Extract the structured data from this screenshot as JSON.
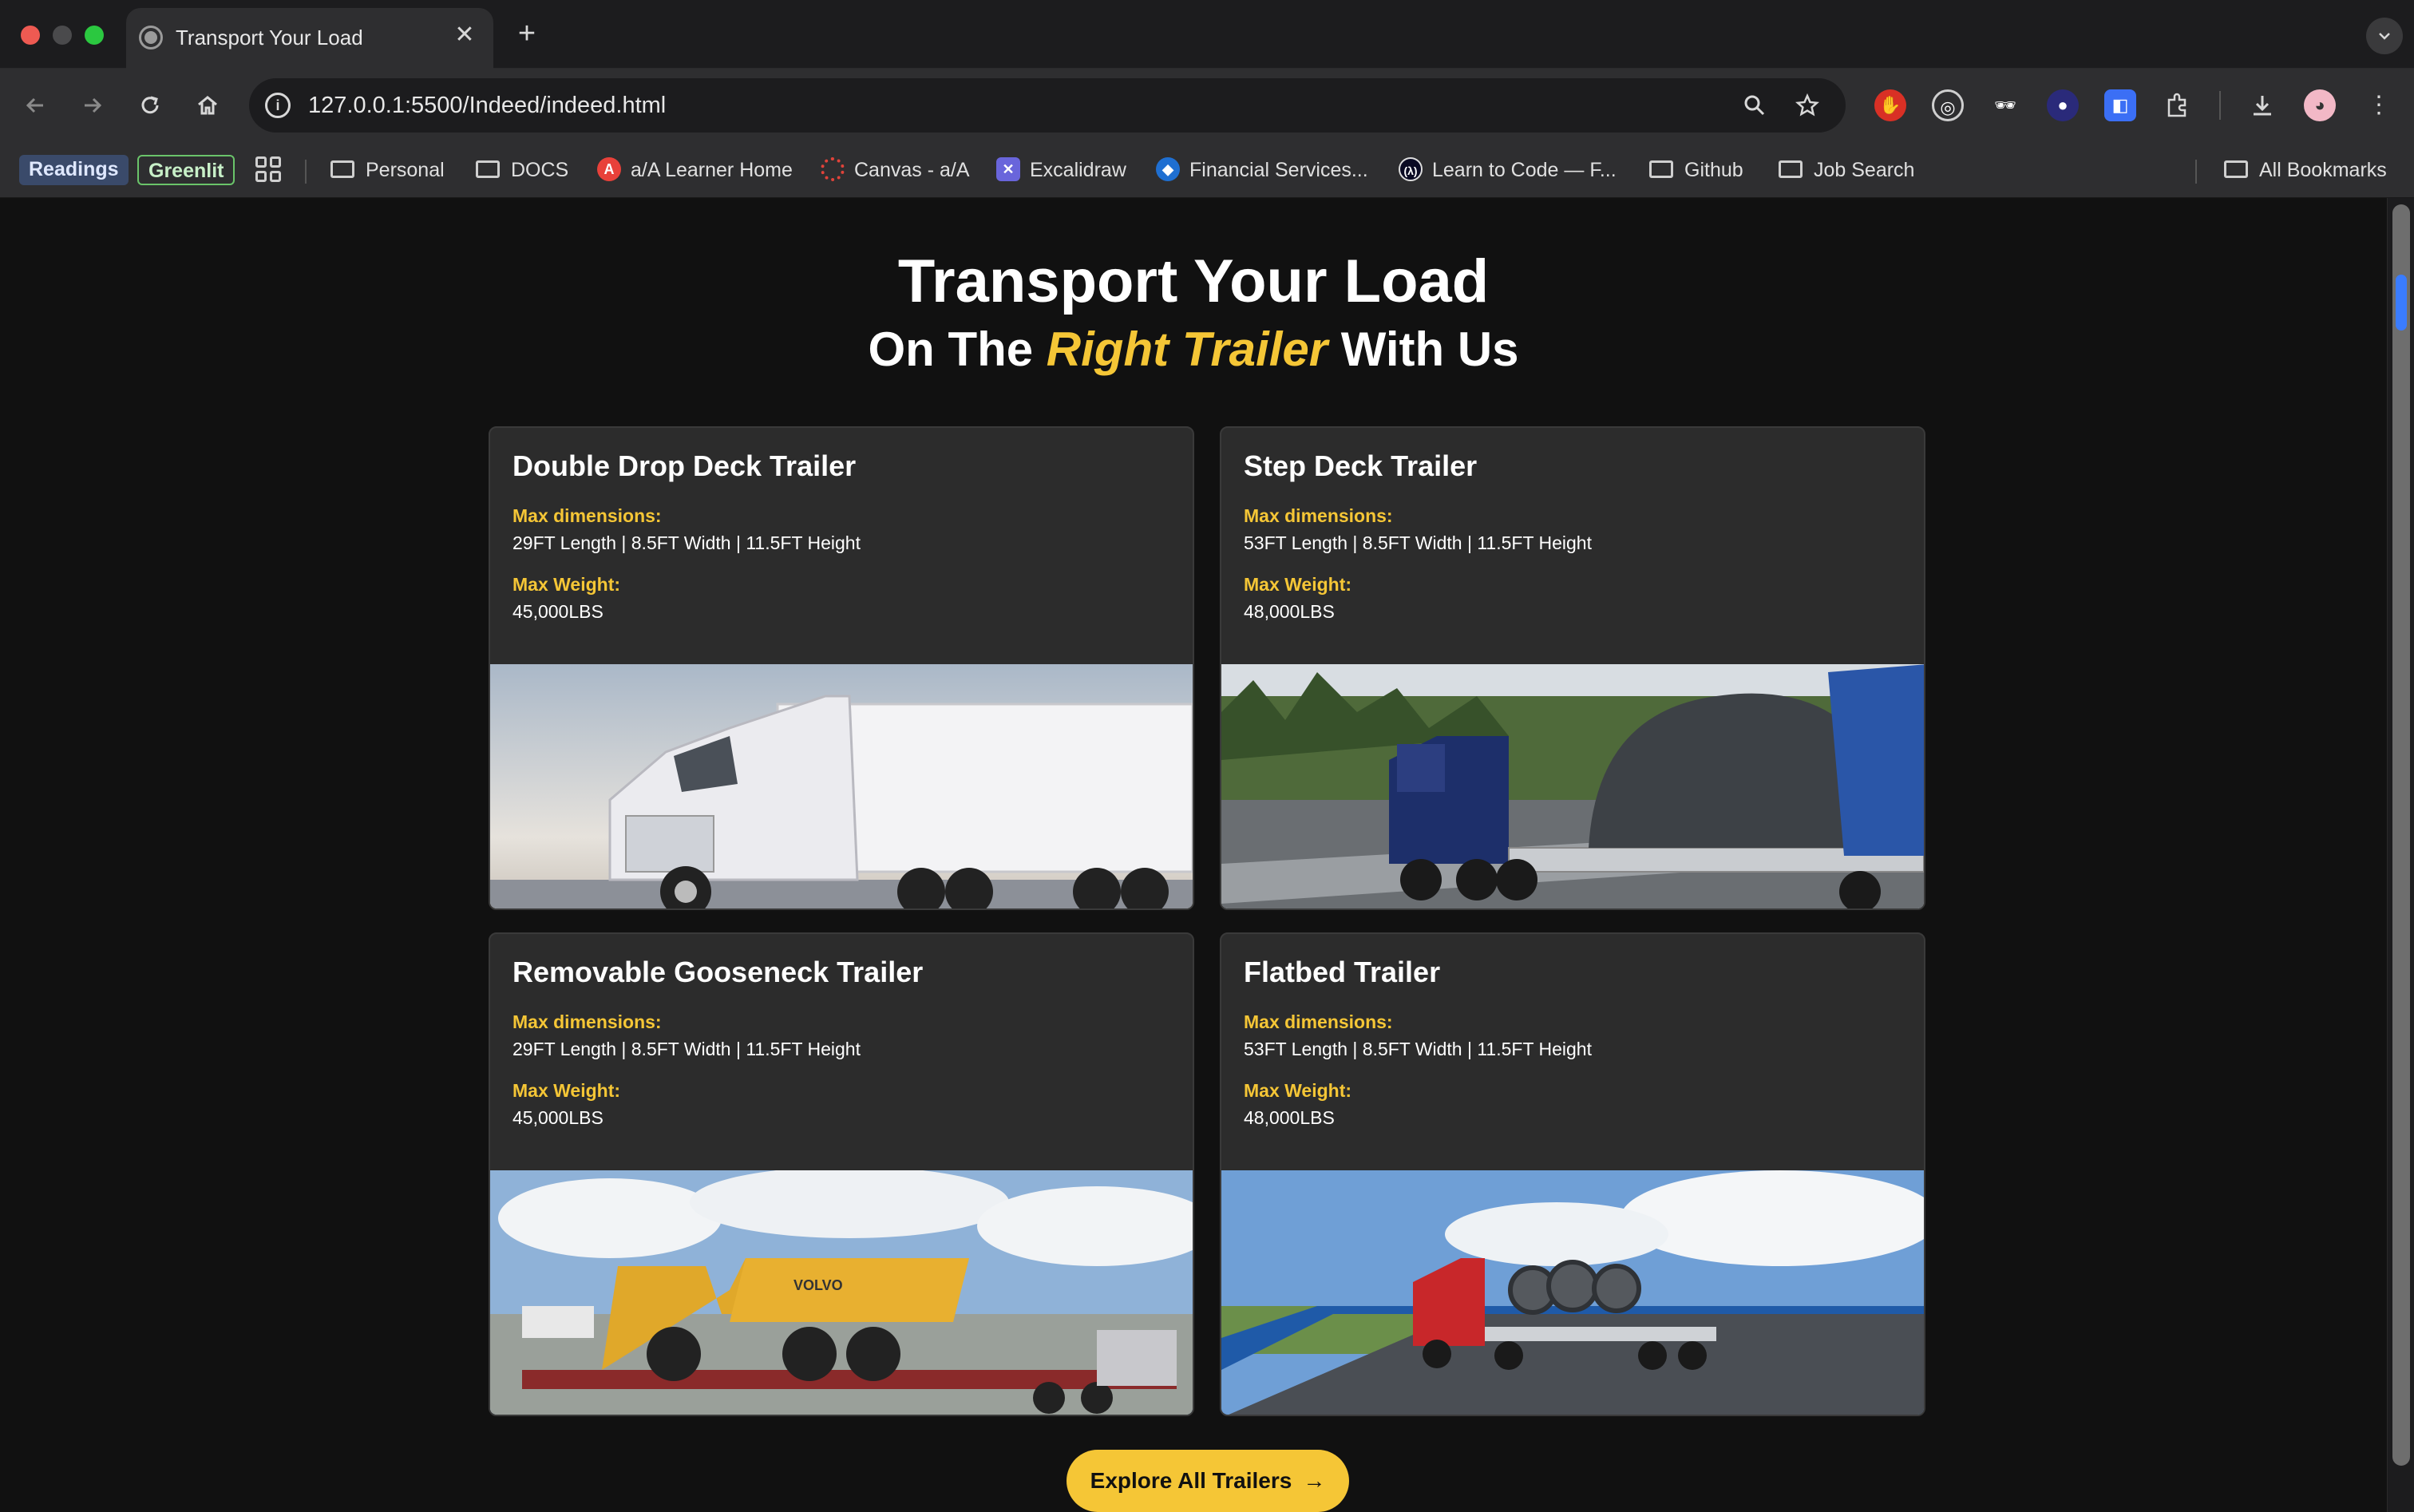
{
  "browser": {
    "tab_title": "Transport Your Load",
    "close_glyph": "✕",
    "new_tab_glyph": "+",
    "url": "127.0.0.1:5500/Indeed/indeed.html",
    "bookmarks": [
      {
        "label": "Readings",
        "kind": "chip"
      },
      {
        "label": "Greenlit",
        "kind": "chip"
      },
      {
        "label": "Personal",
        "kind": "folder"
      },
      {
        "label": "DOCS",
        "kind": "folder"
      },
      {
        "label": "a/A Learner Home",
        "kind": "site"
      },
      {
        "label": "Canvas - a/A",
        "kind": "site"
      },
      {
        "label": "Excalidraw",
        "kind": "site"
      },
      {
        "label": "Financial Services...",
        "kind": "site"
      },
      {
        "label": "Learn to Code — F...",
        "kind": "site"
      },
      {
        "label": "Github",
        "kind": "folder"
      },
      {
        "label": "Job Search",
        "kind": "folder"
      },
      {
        "label": "All Bookmarks",
        "kind": "folder"
      }
    ]
  },
  "hero": {
    "title": "Transport Your Load",
    "subtitle_before": "On The ",
    "subtitle_accent": "Right Trailer",
    "subtitle_after": " With Us"
  },
  "colors": {
    "accent": "#f5c636",
    "background": "#111111",
    "card": "#2c2c2c"
  },
  "cards": [
    {
      "title": "Double Drop Deck Trailer",
      "dim_label": "Max dimensions:",
      "dimensions": "29FT Length | 8.5FT Width | 11.5FT Height",
      "weight_label": "Max Weight:",
      "weight": "45,000LBS",
      "image": "white-semi-truck-photo"
    },
    {
      "title": "Step Deck Trailer",
      "dim_label": "Max dimensions:",
      "dimensions": "53FT Length | 8.5FT Width | 11.5FT Height",
      "weight_label": "Max Weight:",
      "weight": "48,000LBS",
      "image": "blue-truck-tarped-load-photo"
    },
    {
      "title": "Removable Gooseneck Trailer",
      "dim_label": "Max dimensions:",
      "dimensions": "29FT Length | 8.5FT Width | 11.5FT Height",
      "weight_label": "Max Weight:",
      "weight": "45,000LBS",
      "image": "dump-truck-on-lowboy-photo"
    },
    {
      "title": "Flatbed Trailer",
      "dim_label": "Max dimensions:",
      "dimensions": "53FT Length | 8.5FT Width | 11.5FT Height",
      "weight_label": "Max Weight:",
      "weight": "48,000LBS",
      "image": "red-truck-steel-coils-photo"
    }
  ],
  "cta": {
    "label": "Explore All Trailers",
    "arrow": "→"
  },
  "icons": {
    "volvo_text": "VOLVO"
  }
}
